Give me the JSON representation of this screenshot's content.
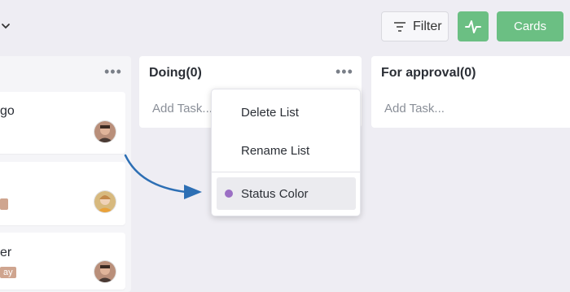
{
  "toolbar": {
    "filter_label": "Filter",
    "cards_label": "Cards",
    "accent_color": "#6bbf83"
  },
  "columns": {
    "left": {
      "cards": [
        {
          "text": "go"
        },
        {
          "text": ""
        },
        {
          "text": "er",
          "tag": "ay"
        }
      ]
    },
    "doing": {
      "title": "Doing(0)",
      "add_task": "Add Task..."
    },
    "approval": {
      "title": "For approval(0)",
      "add_task": "Add Task..."
    }
  },
  "menu": {
    "items": [
      {
        "label": "Delete List"
      },
      {
        "label": "Rename List"
      },
      {
        "label": "Status Color",
        "dot_color": "#9b6fc4"
      }
    ]
  },
  "icons": {
    "chevron": "chevron-down-icon",
    "filter": "filter-lines-icon",
    "activity": "activity-pulse-icon",
    "more": "more-dots-icon",
    "annotation": "curved-arrow-icon"
  }
}
